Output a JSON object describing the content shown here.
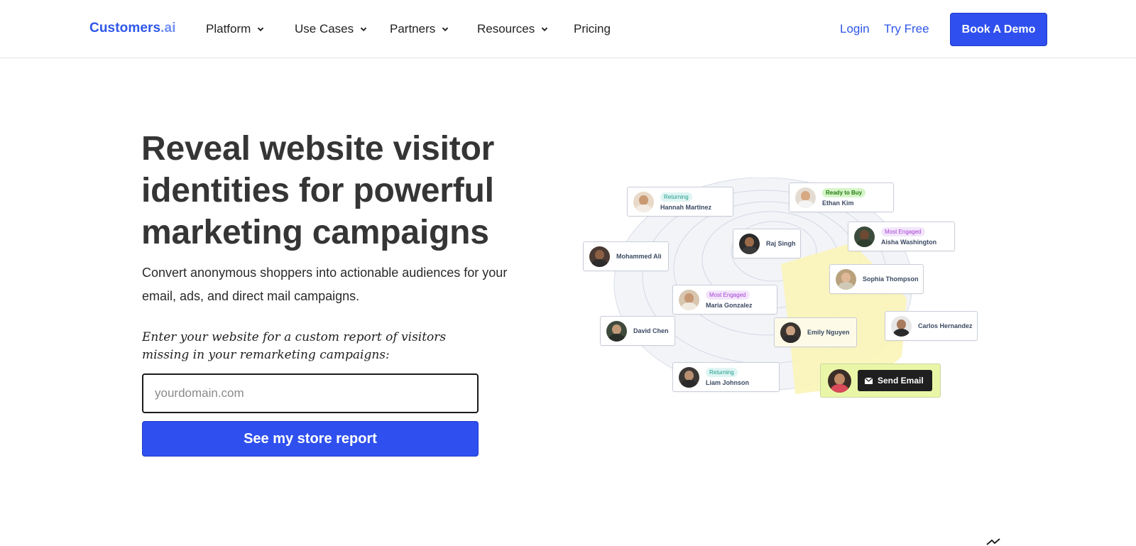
{
  "nav": {
    "logo_main": "Customers",
    "logo_suffix": ".ai",
    "items": [
      {
        "label": "Platform",
        "icon": "chevron-down-icon"
      },
      {
        "label": "Use Cases",
        "icon": "chevron-down-icon"
      },
      {
        "label": "Partners",
        "icon": "chevron-down-icon"
      },
      {
        "label": "Resources",
        "icon": "chevron-down-icon"
      }
    ],
    "pricing": "Pricing",
    "login": "Login",
    "try_free": "Try Free",
    "book_demo": "Book A Demo"
  },
  "hero": {
    "title": "Reveal website visitor identities for powerful marketing campaigns",
    "subtitle": "Convert anonymous shoppers into actionable audiences for your email, ads, and direct mail campaigns.",
    "cta_label": "Enter your website for a custom report of visitors missing in your remarketing campaigns:",
    "input_placeholder": "yourdomain.com",
    "button": "See my store report"
  },
  "illustration": {
    "contacts": [
      {
        "name": "Hannah Martinez",
        "tag": "Returning"
      },
      {
        "name": "Ethan Kim",
        "tag": "Ready to Buy"
      },
      {
        "name": "Raj Singh",
        "tag": ""
      },
      {
        "name": "Aisha Washington",
        "tag": "Most Engaged"
      },
      {
        "name": "Mohammed Ali",
        "tag": ""
      },
      {
        "name": "Sophia Thompson",
        "tag": ""
      },
      {
        "name": "Maria Gonzalez",
        "tag": "Most Engaged"
      },
      {
        "name": "David Chen",
        "tag": ""
      },
      {
        "name": "Emily Nguyen",
        "tag": ""
      },
      {
        "name": "Carlos Hernandez",
        "tag": ""
      },
      {
        "name": "Liam Johnson",
        "tag": "Returning"
      }
    ],
    "send_email": "Send Email",
    "colors": {
      "accent": "#2f50ee",
      "highlight": "#fbf4b8",
      "send_bg": "#eaf6a7"
    }
  }
}
